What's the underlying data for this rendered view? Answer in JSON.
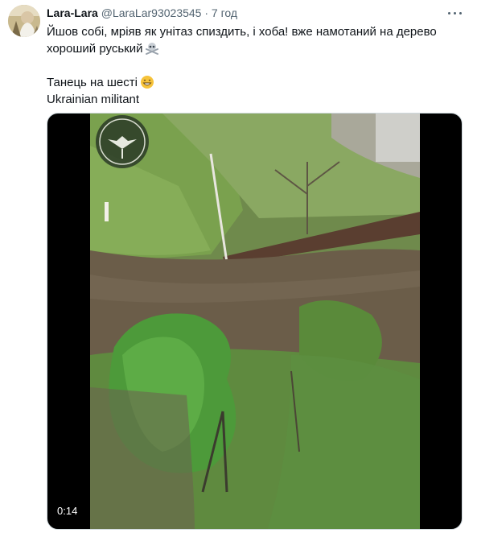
{
  "author": {
    "name": "Lara-Lara",
    "handle": "@LaraLar93023545",
    "separator": "·",
    "time": "7 год"
  },
  "tweet": {
    "line1": "Йшов собі, мріяв як унітаз спиздить,  і хоба! вже намотаний на дерево",
    "line2": "хороший руський",
    "line3": "Танець на шесті",
    "line4": "Ukrainian militant"
  },
  "video": {
    "timestamp": "0:14"
  },
  "icons": {
    "more": "more-horizontal-icon",
    "skull": "skull-crossbones-emoji",
    "grin": "grinning-emoji"
  }
}
